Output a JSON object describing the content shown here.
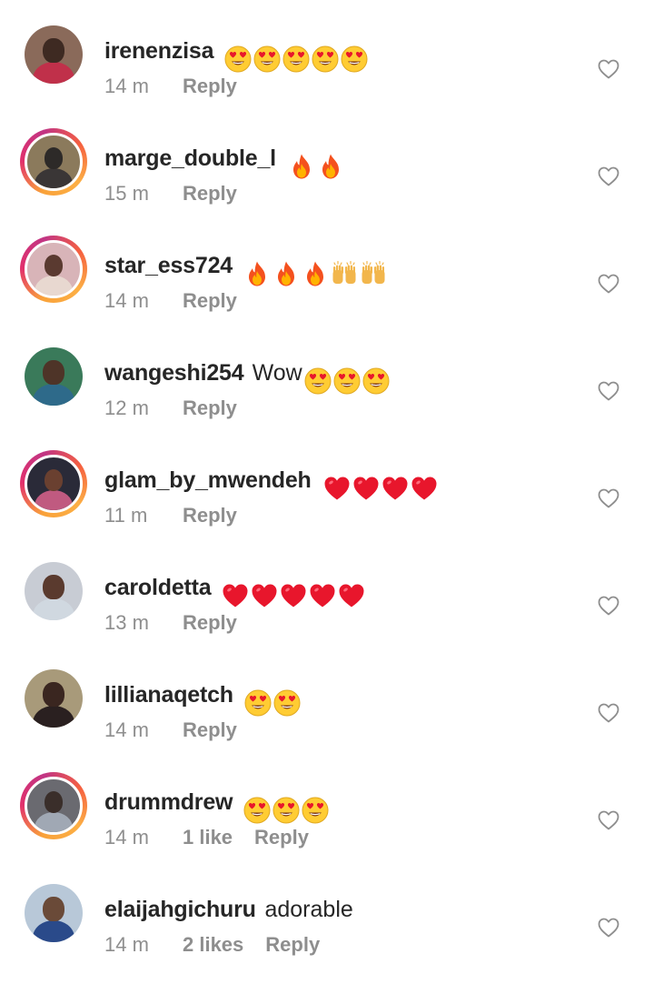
{
  "comments": [
    {
      "username": "irenenzisa",
      "text": "",
      "emojis": [
        "😍",
        "😍",
        "😍",
        "😍",
        "😍"
      ],
      "emoji_kind": "heart-eyes",
      "time": "14 m",
      "likes": "",
      "reply_label": "Reply",
      "has_story_ring": false,
      "avatar_colors": {
        "bg": "#8a6a5a",
        "face": "#3e2a22",
        "torso": "#c0304a"
      }
    },
    {
      "username": "marge_double_l",
      "text": "",
      "emojis": [
        "🔥",
        "🔥"
      ],
      "emoji_kind": "fire",
      "time": "15 m",
      "likes": "",
      "reply_label": "Reply",
      "has_story_ring": true,
      "avatar_colors": {
        "bg": "#8b7a5c",
        "face": "#2d2a28",
        "torso": "#3a3636"
      }
    },
    {
      "username": "star_ess724",
      "text": "",
      "emojis": [
        "🔥",
        "🔥",
        "🔥",
        "🙌",
        "🙌"
      ],
      "emoji_kind": "fire-raised-hands",
      "time": "14 m",
      "likes": "",
      "reply_label": "Reply",
      "has_story_ring": true,
      "avatar_colors": {
        "bg": "#d8b4b8",
        "face": "#5a3a30",
        "torso": "#e8d8d0"
      }
    },
    {
      "username": "wangeshi254",
      "text": "Wow",
      "emojis": [
        "😍",
        "😍",
        "😍"
      ],
      "emoji_kind": "heart-eyes",
      "time": "12 m",
      "likes": "",
      "reply_label": "Reply",
      "has_story_ring": false,
      "avatar_colors": {
        "bg": "#3a7a5a",
        "face": "#4e3428",
        "torso": "#2e6a8a"
      }
    },
    {
      "username": "glam_by_mwendeh",
      "text": "",
      "emojis": [
        "❤️",
        "❤️",
        "❤️",
        "❤️"
      ],
      "emoji_kind": "red-heart",
      "time": "11 m",
      "likes": "",
      "reply_label": "Reply",
      "has_story_ring": true,
      "avatar_colors": {
        "bg": "#2a2a38",
        "face": "#6a4030",
        "torso": "#c05a80"
      }
    },
    {
      "username": "caroldetta",
      "text": "",
      "emojis": [
        "❤️",
        "❤️",
        "❤️",
        "❤️",
        "❤️"
      ],
      "emoji_kind": "red-heart",
      "time": "13 m",
      "likes": "",
      "reply_label": "Reply",
      "has_story_ring": false,
      "avatar_colors": {
        "bg": "#c8ccd4",
        "face": "#5a3a2e",
        "torso": "#d0d8e0"
      }
    },
    {
      "username": "lillianaqetch",
      "text": "",
      "emojis": [
        "😍",
        "😍"
      ],
      "emoji_kind": "heart-eyes",
      "time": "14 m",
      "likes": "",
      "reply_label": "Reply",
      "has_story_ring": false,
      "avatar_colors": {
        "bg": "#a89a7a",
        "face": "#3a2620",
        "torso": "#2a2020"
      }
    },
    {
      "username": "drummdrew",
      "text": "",
      "emojis": [
        "😍",
        "😍",
        "😍"
      ],
      "emoji_kind": "heart-eyes",
      "time": "14 m",
      "likes": "1 like",
      "reply_label": "Reply",
      "has_story_ring": true,
      "avatar_colors": {
        "bg": "#6a6a70",
        "face": "#3a2e2a",
        "torso": "#a0a8b4"
      }
    },
    {
      "username": "elaijahgichuru",
      "text": "adorable",
      "emojis": [],
      "emoji_kind": "",
      "time": "14 m",
      "likes": "2 likes",
      "reply_label": "Reply",
      "has_story_ring": false,
      "avatar_colors": {
        "bg": "#b8c8d8",
        "face": "#6a4a38",
        "torso": "#2a4a8a"
      }
    }
  ],
  "colors": {
    "text_primary": "#262626",
    "text_secondary": "#8e8e8e",
    "heart_outline": "#8e8e8e",
    "emoji_red": "#e8162c",
    "emoji_yellow": "#ffcc33"
  },
  "icons": {
    "like": "heart-outline-icon"
  }
}
